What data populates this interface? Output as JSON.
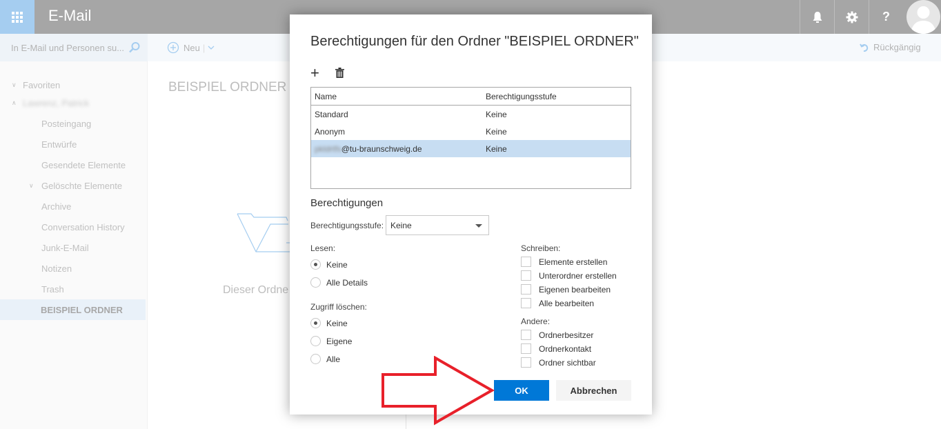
{
  "header": {
    "app_title": "E-Mail",
    "icons": [
      "app-launcher-icon",
      "bell-icon",
      "gear-icon",
      "help-icon",
      "avatar-icon"
    ],
    "help_glyph": "?"
  },
  "toolbar": {
    "search_placeholder": "In E-Mail und Personen su...",
    "new_label": "Neu",
    "undo_label": "Rückgängig"
  },
  "sidebar": {
    "favorites_label": "Favoriten",
    "account_label": "Lawrenz, Patrick",
    "items": [
      {
        "label": "Posteingang"
      },
      {
        "label": "Entwürfe"
      },
      {
        "label": "Gesendete Elemente"
      },
      {
        "label": "Gelöschte Elemente"
      },
      {
        "label": "Archive"
      },
      {
        "label": "Conversation History"
      },
      {
        "label": "Junk-E-Mail"
      },
      {
        "label": "Notizen"
      },
      {
        "label": "Trash"
      },
      {
        "label": "BEISPIEL ORDNER",
        "selected": true
      }
    ]
  },
  "content": {
    "folder_title": "BEISPIEL ORDNER",
    "empty_text": "Dieser Ordne"
  },
  "dialog": {
    "title": "Berechtigungen für den Ordner \"BEISPIEL ORDNER\"",
    "add_glyph": "+",
    "table": {
      "headers": [
        "Name",
        "Berechtigungsstufe"
      ],
      "rows": [
        {
          "name": "Standard",
          "level": "Keine"
        },
        {
          "name": "Anonym",
          "level": "Keine"
        },
        {
          "name_blurred": "pkldrtfs",
          "name_domain": "@tu-braunschweig.de",
          "level": "Keine",
          "selected": true
        }
      ]
    },
    "permissions_title": "Berechtigungen",
    "level_label": "Berechtigungsstufe:",
    "level_value": "Keine",
    "read": {
      "label": "Lesen:",
      "options": [
        {
          "label": "Keine",
          "checked": true
        },
        {
          "label": "Alle Details",
          "checked": false
        }
      ]
    },
    "delete": {
      "label": "Zugriff löschen:",
      "options": [
        {
          "label": "Keine",
          "checked": true
        },
        {
          "label": "Eigene",
          "checked": false
        },
        {
          "label": "Alle",
          "checked": false
        }
      ]
    },
    "write": {
      "label": "Schreiben:",
      "options": [
        {
          "label": "Elemente erstellen",
          "checked": false
        },
        {
          "label": "Unterordner erstellen",
          "checked": false
        },
        {
          "label": "Eigenen bearbeiten",
          "checked": false
        },
        {
          "label": "Alle bearbeiten",
          "checked": false
        }
      ]
    },
    "other": {
      "label": "Andere:",
      "options": [
        {
          "label": "Ordnerbesitzer",
          "checked": false
        },
        {
          "label": "Ordnerkontakt",
          "checked": false
        },
        {
          "label": "Ordner sichtbar",
          "checked": false
        }
      ]
    },
    "ok_label": "OK",
    "cancel_label": "Abbrechen"
  },
  "colors": {
    "accent": "#0078d7",
    "selection": "#c7ddf2",
    "annotation_arrow": "#e8202a"
  }
}
